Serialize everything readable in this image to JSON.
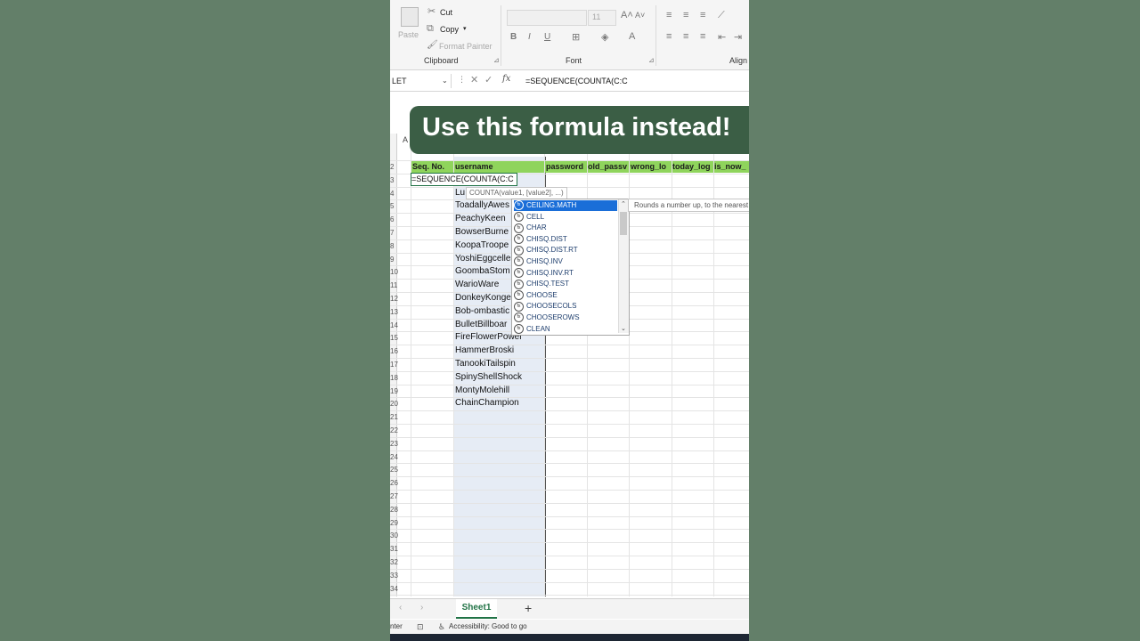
{
  "banner": {
    "text": "Use this formula instead!"
  },
  "ribbon": {
    "clipboard": {
      "paste": "Paste",
      "cut": "Cut",
      "copy": "Copy",
      "format_painter": "Format Painter",
      "label": "Clipboard"
    },
    "font": {
      "size": "11",
      "label": "Font",
      "bold": "B",
      "italic": "I",
      "underline": "U"
    },
    "alignment": {
      "label": "Align"
    }
  },
  "formula_bar": {
    "name_box": "LET",
    "formula": "=SEQUENCE(COUNTA(C:C"
  },
  "grid": {
    "column_a_header": "A",
    "headers": [
      "Seq. No.",
      "username",
      "password",
      "old_passv",
      "wrong_lo",
      "today_log",
      "is_now_"
    ],
    "active_cell": "=SEQUENCE(COUNTA(C:C",
    "usernames": [
      "Lu",
      "ToadallyAwes",
      "PeachyKeen",
      "BowserBurne",
      "KoopaTroope",
      "YoshiEggcelle",
      "GoombaStom",
      "WarioWare",
      "DonkeyKonge",
      "Bob-ombastic",
      "BulletBillboar",
      "FireFlowerPower",
      "HammerBroski",
      "TanookiTailspin",
      "SpinyShellShock",
      "MontyMolehill",
      "ChainChampion"
    ],
    "row_numbers": [
      "2",
      "3",
      "4",
      "5",
      "6",
      "7",
      "8",
      "9",
      "10",
      "11",
      "12",
      "13",
      "14",
      "15",
      "16",
      "17",
      "18",
      "19",
      "20",
      "21",
      "22",
      "23",
      "24",
      "25",
      "26",
      "27",
      "28",
      "29",
      "30",
      "31",
      "32",
      "33",
      "34"
    ]
  },
  "tooltip": "COUNTA(value1, [value2], ...)",
  "autocomplete": {
    "items": [
      "CEILING.MATH",
      "CELL",
      "CHAR",
      "CHISQ.DIST",
      "CHISQ.DIST.RT",
      "CHISQ.INV",
      "CHISQ.INV.RT",
      "CHISQ.TEST",
      "CHOOSE",
      "CHOOSECOLS",
      "CHOOSEROWS",
      "CLEAN"
    ],
    "selected_index": 0,
    "description": "Rounds a number up, to the nearest"
  },
  "sheet_tabs": {
    "active": "Sheet1",
    "add": "+"
  },
  "status_bar": {
    "mode": "nter",
    "accessibility": "Accessibility: Good to go"
  },
  "colors": {
    "header_green": "#8fd45c",
    "banner_bg": "#3b5e45",
    "selection_blue": "#1a6ed8",
    "excel_green": "#217346",
    "backdrop": "#637f69"
  }
}
